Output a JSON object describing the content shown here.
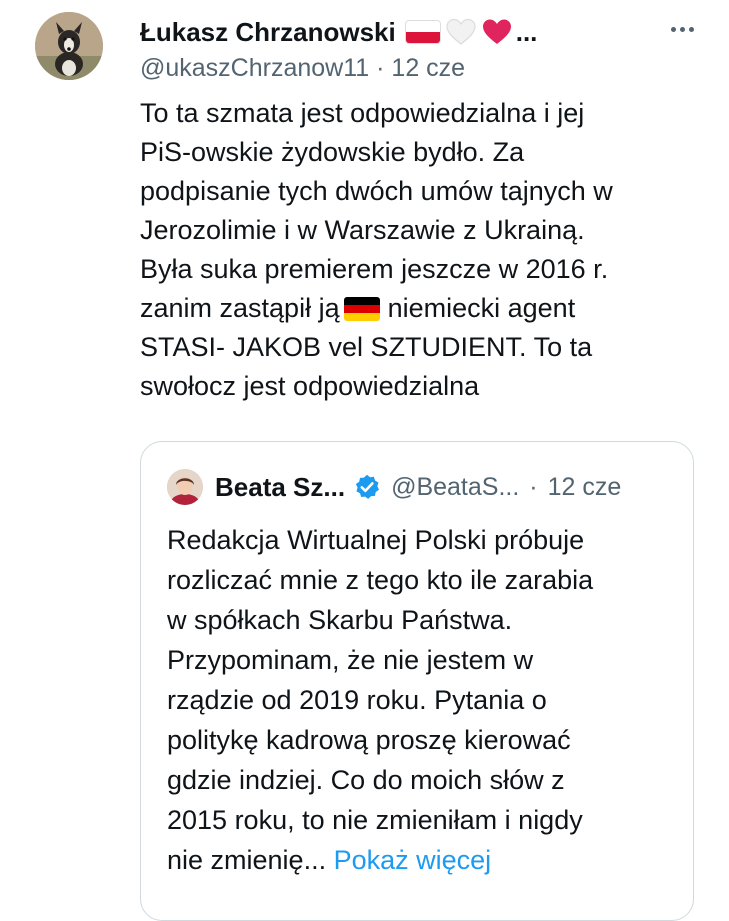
{
  "tweet": {
    "display_name": "Łukasz Chrzanowski",
    "name_ellipsis": "...",
    "handle": "@ukaszChrzanow11",
    "separator": "·",
    "time": "12 cze",
    "text_lines": [
      "To ta szmata jest odpowiedzialna i jej",
      "PiS-owskie żydowskie bydło. Za",
      "podpisanie tych dwóch umów tajnych w",
      "Jerozolimie i w Warszawie z Ukrainą.",
      "Była suka premierem jeszcze w 2016 r.",
      "zanim zastąpił ją",
      "niemiecki agent",
      "STASI- JAKOB vel SZTUDIENT. To ta",
      "swołocz jest odpowiedzialna"
    ],
    "icons": {
      "flag": "poland-flag-icon",
      "white_heart": "white-heart-icon",
      "red_heart": "red-heart-icon",
      "inline_flag": "germany-flag-icon",
      "more": "more-options-icon"
    }
  },
  "quote": {
    "display_name": "Beata Sz...",
    "handle": "@BeataS...",
    "separator": "·",
    "time": "12 cze",
    "text_lines": [
      "Redakcja Wirtualnej Polski próbuje",
      "rozliczać mnie z tego kto ile zarabia",
      "w spółkach Skarbu Państwa.",
      "Przypominam, że nie jestem w",
      "rządzie od 2019 roku. Pytania o",
      "politykę kadrową proszę kierować",
      "gdzie indziej. Co do moich słów z",
      "2015 roku, to nie zmieniłam i nigdy",
      "nie zmienię..."
    ],
    "show_more": "Pokaż więcej",
    "icons": {
      "verified": "verified-badge-icon"
    }
  },
  "colors": {
    "text": "#0f1419",
    "secondary": "#536471",
    "link": "#1d9bf0",
    "border": "#cfd9de",
    "verified": "#1d9bf0",
    "heart": "#e0245e"
  }
}
